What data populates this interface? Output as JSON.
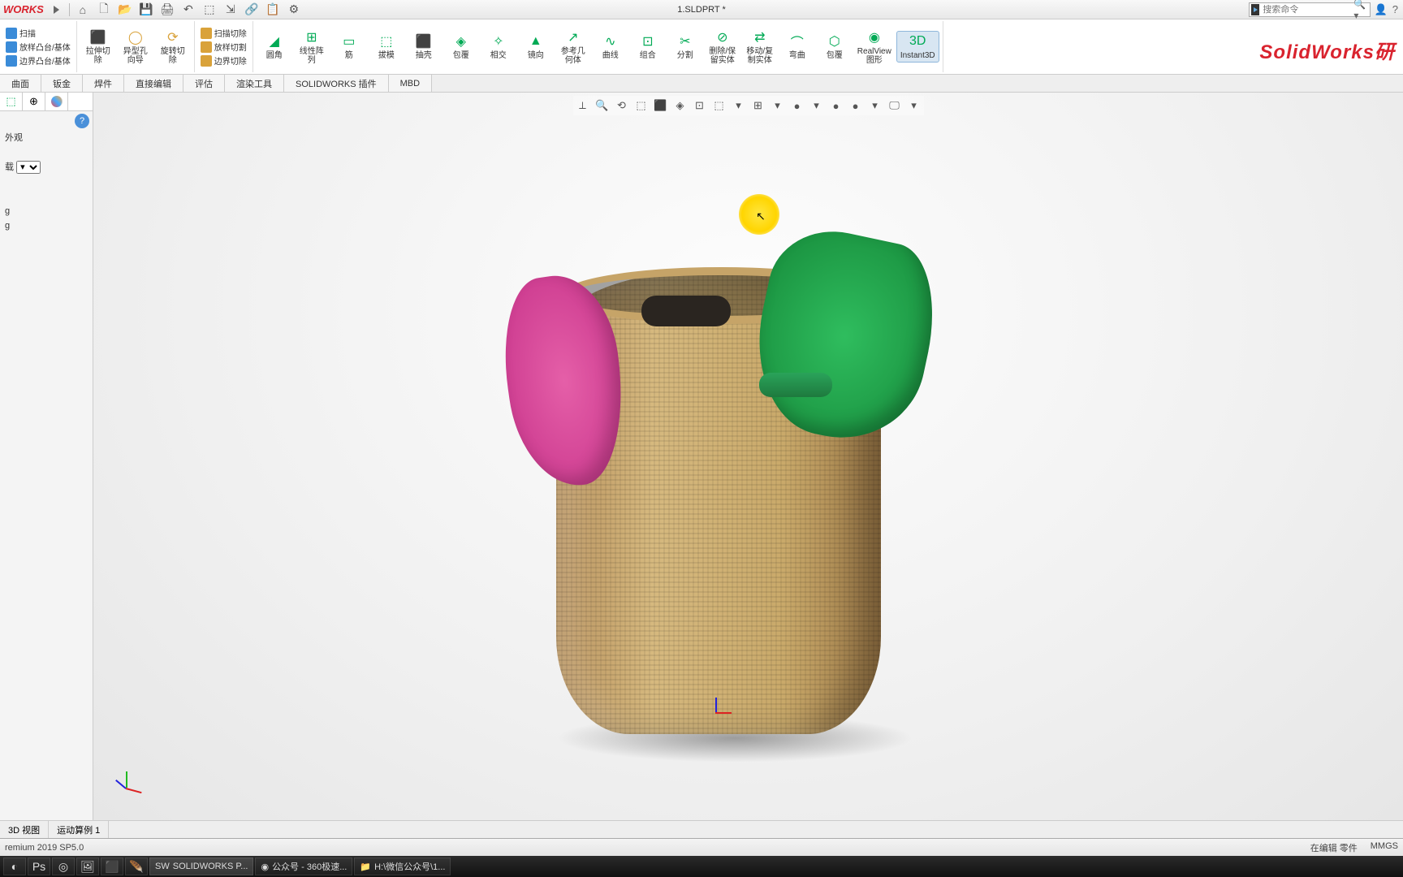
{
  "app": {
    "logo": "WORKS",
    "doc_title": "1.SLDPRT *",
    "search_placeholder": "搜索命令"
  },
  "qat": [
    "⌂",
    "🗋",
    "📂",
    "💾",
    "🖨",
    "↶",
    "⬚",
    "⇲",
    "🔗",
    "📋",
    "⚙"
  ],
  "ribbon": {
    "left_col": [
      "扫描",
      "放样凸台/基体",
      "边界凸台/基体"
    ],
    "groups": [
      {
        "icon": "⬛",
        "label": "拉伸切\n除"
      },
      {
        "icon": "◯",
        "label": "异型孔\n向导"
      },
      {
        "icon": "⟳",
        "label": "旋转切\n除"
      }
    ],
    "center_col": [
      "扫描切除",
      "放样切割",
      "边界切除"
    ],
    "groups2": [
      {
        "icon": "◢",
        "label": "圆角"
      },
      {
        "icon": "⊞",
        "label": "线性阵\n列"
      },
      {
        "icon": "▭",
        "label": "筋"
      },
      {
        "icon": "⬚",
        "label": "拔模"
      },
      {
        "icon": "⬛",
        "label": "抽壳"
      },
      {
        "icon": "◈",
        "label": "包覆"
      },
      {
        "icon": "✧",
        "label": "相交"
      },
      {
        "icon": "▲",
        "label": "镜向"
      },
      {
        "icon": "↗",
        "label": "参考几\n何体"
      },
      {
        "icon": "∿",
        "label": "曲线"
      },
      {
        "icon": "⊡",
        "label": "组合"
      },
      {
        "icon": "✂",
        "label": "分割"
      },
      {
        "icon": "⊘",
        "label": "删除/保\n留实体"
      },
      {
        "icon": "⇄",
        "label": "移动/复\n制实体"
      },
      {
        "icon": "⌒",
        "label": "弯曲"
      },
      {
        "icon": "⬡",
        "label": "包覆"
      },
      {
        "icon": "◉",
        "label": "RealView\n图形"
      },
      {
        "icon": "3D",
        "label": "Instant3D"
      }
    ]
  },
  "watermark": "SolidWorks研",
  "cm_tabs": [
    "曲面",
    "钣金",
    "焊件",
    "直接编辑",
    "评估",
    "渲染工具",
    "SOLIDWORKS 插件",
    "MBD"
  ],
  "feature_panel": {
    "title": "外观",
    "combo": "载",
    "t1": "g",
    "t2": "g"
  },
  "view_toolbar": [
    "⟂",
    "🔍",
    "⟲",
    "⬚",
    "⬛",
    "◈",
    "⊡",
    "⬚",
    "▾",
    "⊞",
    "▾",
    "●",
    "▾",
    "●",
    "●",
    "▾",
    "🖵",
    "▾"
  ],
  "model_tabs": [
    "3D 视图",
    "运动算例 1"
  ],
  "status": {
    "left": "remium 2019 SP5.0",
    "edit": "在编辑 零件",
    "units": "MMGS"
  },
  "taskbar": {
    "pins": [
      "Ps",
      "◎",
      "🖼",
      "⬛",
      "🪶"
    ],
    "apps": [
      {
        "ico": "SW",
        "label": "SOLIDWORKS P...",
        "active": true
      },
      {
        "ico": "◉",
        "label": "公众号 - 360极速..."
      },
      {
        "ico": "📁",
        "label": "H:\\微信公众号\\1..."
      }
    ]
  }
}
